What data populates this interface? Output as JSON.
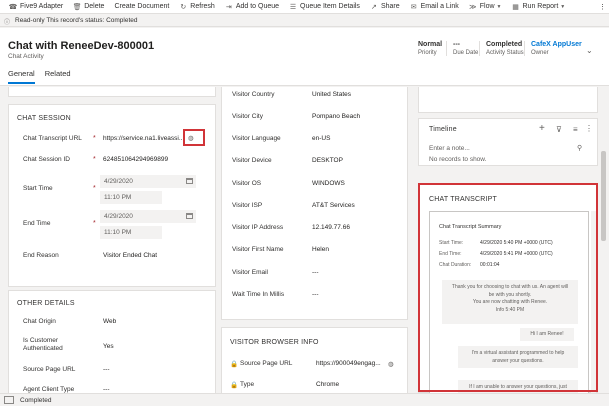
{
  "toolbar": {
    "items": [
      {
        "label": "Five9 Adapter",
        "icon": "phone-icon"
      },
      {
        "label": "Delete",
        "icon": "trash-icon"
      },
      {
        "label": "Create Document",
        "icon": ""
      },
      {
        "label": "Refresh",
        "icon": "refresh-icon"
      },
      {
        "label": "Add to Queue",
        "icon": "queue-add-icon"
      },
      {
        "label": "Queue Item Details",
        "icon": "list-icon"
      },
      {
        "label": "Share",
        "icon": "share-icon"
      },
      {
        "label": "Email a Link",
        "icon": "mail-icon"
      },
      {
        "label": "Flow",
        "icon": "flow-icon"
      },
      {
        "label": "Run Report",
        "icon": "report-icon"
      }
    ],
    "more": "⋮"
  },
  "notice": {
    "text": "Read-only This record's status: Completed"
  },
  "header": {
    "title": "Chat with ReneeDev-800001",
    "subtitle": "Chat Activity",
    "fields": [
      {
        "value": "Normal",
        "label": "Priority"
      },
      {
        "value": "---",
        "label": "Due Date"
      },
      {
        "value": "Completed",
        "label": "Activity Status"
      },
      {
        "value": "CafeX AppUser",
        "label": "Owner"
      }
    ],
    "tabs": [
      "General",
      "Related"
    ]
  },
  "chat_session": {
    "title": "CHAT SESSION",
    "transcript_url_label": "Chat Transcript URL",
    "transcript_url_value": "https://service.na1.liveassi...",
    "session_id_label": "Chat Session ID",
    "session_id_value": "624851064294969899",
    "start_time_label": "Start Time",
    "start_date": "4/29/2020",
    "start_time": "11:10 PM",
    "end_time_label": "End Time",
    "end_date": "4/29/2020",
    "end_time": "11:10 PM",
    "end_reason_label": "End Reason",
    "end_reason_value": "Visitor Ended Chat"
  },
  "other_details": {
    "title": "OTHER DETAILS",
    "rows": [
      {
        "label": "Chat Origin",
        "value": "Web"
      },
      {
        "label": "Is Customer Authenticated",
        "value": "Yes"
      },
      {
        "label": "Source Page URL",
        "value": "---"
      },
      {
        "label": "Agent Client Type",
        "value": "---"
      }
    ]
  },
  "visitor": {
    "rows": [
      {
        "label": "Visitor Country",
        "value": "United States"
      },
      {
        "label": "Visitor City",
        "value": "Pompano Beach"
      },
      {
        "label": "Visitor Language",
        "value": "en-US"
      },
      {
        "label": "Visitor Device",
        "value": "DESKTOP"
      },
      {
        "label": "Visitor OS",
        "value": "WINDOWS"
      },
      {
        "label": "Visitor ISP",
        "value": "AT&T Services"
      },
      {
        "label": "Visitor IP Address",
        "value": "12.149.77.66"
      },
      {
        "label": "Visitor First Name",
        "value": "Helen"
      },
      {
        "label": "Visitor Email",
        "value": "---"
      },
      {
        "label": "Wait Time In Millis",
        "value": "---"
      }
    ]
  },
  "browser": {
    "title": "VISITOR BROWSER INFO",
    "source_label": "Source Page URL",
    "source_value": "https://900049engag...",
    "type_label": "Type",
    "type_value": "Chrome"
  },
  "timeline": {
    "title": "Timeline",
    "placeholder": "Enter a note...",
    "empty": "No records to show."
  },
  "transcript": {
    "title": "CHAT TRANSCRIPT",
    "summary_title": "Chat Transcript Summary",
    "start_label": "Start Time:",
    "start_value": "4/29/2020 5:40 PM +0000 (UTC)",
    "end_label": "End Time:",
    "end_value": "4/29/2020 5:41 PM +0000 (UTC)",
    "duration_label": "Chat Duration:",
    "duration_value": "00:01:04",
    "msg1": "Thank you for choosing to chat with us. An agent will be with you shortly.",
    "msg2": "You are now chatting with Renee.",
    "msg3": "Info 5:40 PM",
    "msg4": "Hi I am Renee!",
    "msg5": "I'm a virtual assistant programmed to help answer your questions.",
    "msg6": "If I am unable to answer your questions, just"
  },
  "status": {
    "text": "Completed"
  },
  "colors": {
    "accent": "#0078d4",
    "highlight": "#d13438"
  }
}
